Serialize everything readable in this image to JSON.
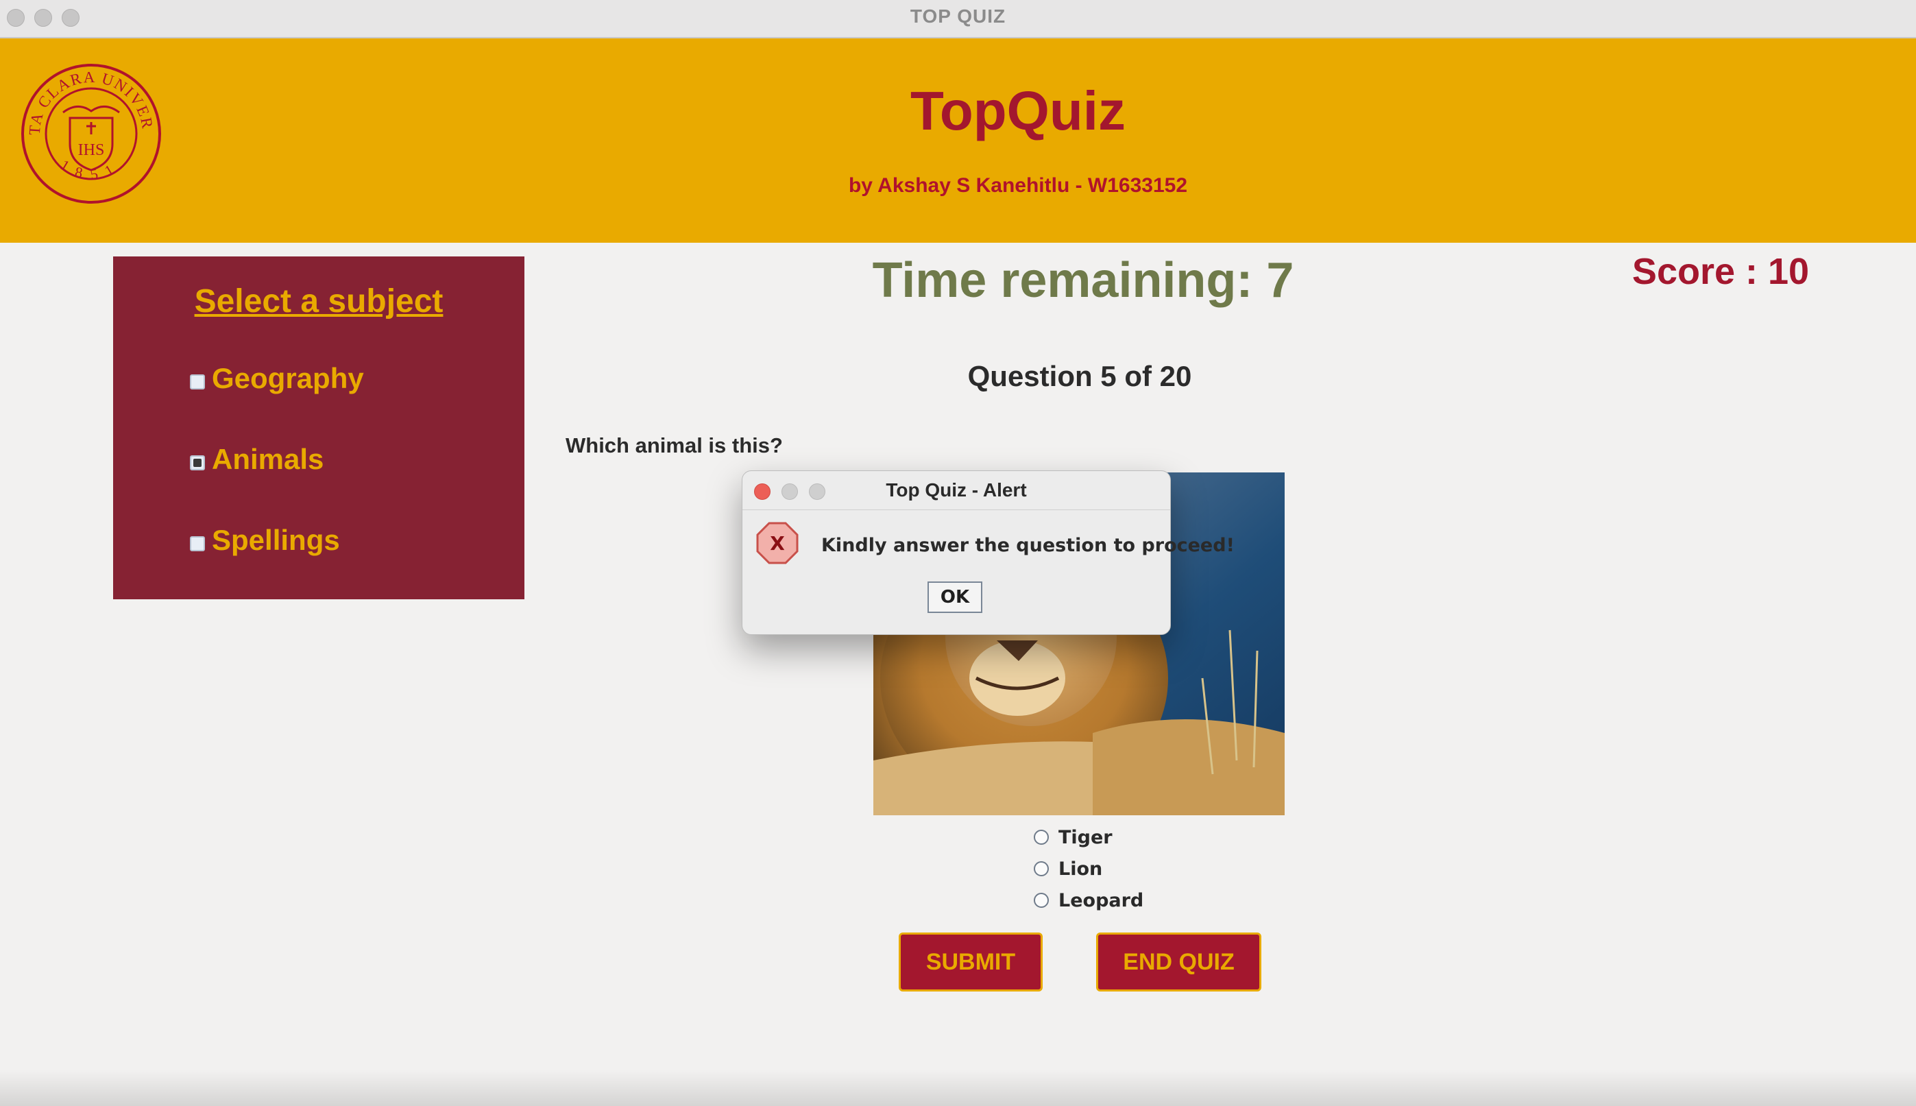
{
  "window": {
    "title": "TOP QUIZ"
  },
  "header": {
    "title": "TopQuiz",
    "subtitle": "by Akshay S Kanehitlu - W1633152",
    "seal_text": "SANTA CLARA UNIVERSITY",
    "seal_year": "1851",
    "seal_monogram": "IHS"
  },
  "sidebar": {
    "heading": "Select a subject",
    "subjects": [
      {
        "label": "Geography",
        "checked": false
      },
      {
        "label": "Animals",
        "checked": true
      },
      {
        "label": "Spellings",
        "checked": false
      }
    ]
  },
  "quiz": {
    "timer": "Time remaining: 7",
    "score": "Score : 10",
    "question_number": "Question 5 of 20",
    "question_text": "Which animal is this?",
    "image_subject": "lion",
    "options": [
      "Tiger",
      "Lion",
      "Leopard"
    ],
    "submit_label": "SUBMIT",
    "end_label": "END QUIZ"
  },
  "dialog": {
    "title": "Top Quiz - Alert",
    "icon": "error-icon",
    "icon_glyph": "X",
    "message": "Kindly answer the question to proceed!",
    "ok_label": "OK"
  },
  "colors": {
    "gold": "#e9aa00",
    "maroon": "#862233",
    "crimson": "#a3172e",
    "timer_olive": "#6f7a4a",
    "background": "#f2f1f0"
  }
}
